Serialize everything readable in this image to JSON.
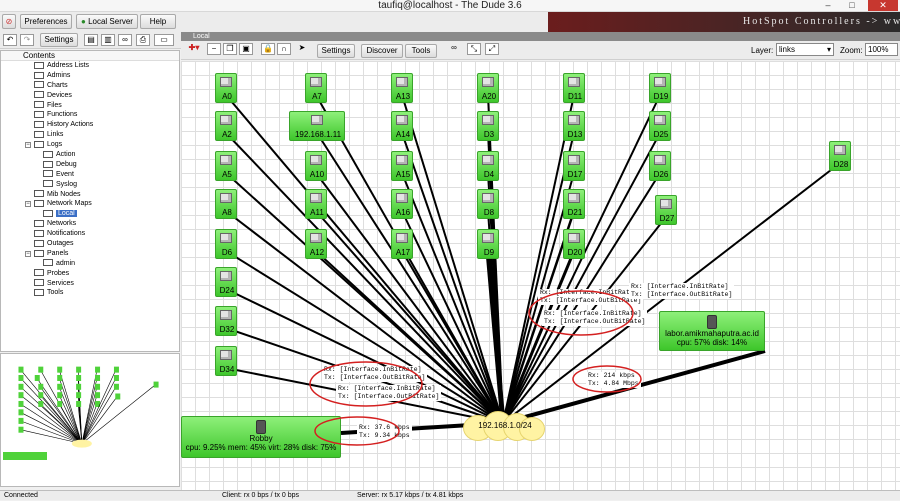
{
  "window": {
    "title": "taufiq@localhost - The Dude 3.6",
    "minimize": "–",
    "maximize": "□",
    "close": "✕"
  },
  "menu": {
    "preferences": "Preferences",
    "local_server": "Local Server",
    "help": "Help"
  },
  "banner": {
    "text": "HotSpot Controllers -> www"
  },
  "toolbar": {
    "settings": "Settings"
  },
  "tree": {
    "header": "Contents",
    "items": [
      {
        "label": "Address Lists",
        "indent": 1
      },
      {
        "label": "Admins",
        "indent": 1
      },
      {
        "label": "Charts",
        "indent": 1
      },
      {
        "label": "Devices",
        "indent": 1
      },
      {
        "label": "Files",
        "indent": 1
      },
      {
        "label": "Functions",
        "indent": 1
      },
      {
        "label": "History Actions",
        "indent": 1
      },
      {
        "label": "Links",
        "indent": 1
      },
      {
        "label": "Logs",
        "indent": 1,
        "expander": "−"
      },
      {
        "label": "Action",
        "indent": 2
      },
      {
        "label": "Debug",
        "indent": 2
      },
      {
        "label": "Event",
        "indent": 2
      },
      {
        "label": "Syslog",
        "indent": 2
      },
      {
        "label": "Mib Nodes",
        "indent": 1
      },
      {
        "label": "Network Maps",
        "indent": 1,
        "expander": "−"
      },
      {
        "label": "Local",
        "indent": 2,
        "selected": true
      },
      {
        "label": "Networks",
        "indent": 1
      },
      {
        "label": "Notifications",
        "indent": 1
      },
      {
        "label": "Outages",
        "indent": 1
      },
      {
        "label": "Panels",
        "indent": 1,
        "expander": "−"
      },
      {
        "label": "admin",
        "indent": 2
      },
      {
        "label": "Probes",
        "indent": 1
      },
      {
        "label": "Services",
        "indent": 1
      },
      {
        "label": "Tools",
        "indent": 1
      }
    ]
  },
  "map_tab": {
    "label": "Local"
  },
  "map_toolbar": {
    "settings": "Settings",
    "discover": "Discover",
    "tools": "Tools",
    "layer_label": "Layer:",
    "layer_value": "links",
    "zoom_label": "Zoom:",
    "zoom_value": "100%"
  },
  "map": {
    "hub": {
      "label": "192.168.1.0/24"
    },
    "nodes": [
      {
        "id": "A0",
        "label": "A0"
      },
      {
        "id": "A2",
        "label": "A2"
      },
      {
        "id": "A5",
        "label": "A5"
      },
      {
        "id": "A8",
        "label": "A8"
      },
      {
        "id": "D6",
        "label": "D6"
      },
      {
        "id": "D24",
        "label": "D24"
      },
      {
        "id": "D32",
        "label": "D32"
      },
      {
        "id": "D34",
        "label": "D34"
      },
      {
        "id": "A7",
        "label": "A7"
      },
      {
        "id": "ip11",
        "label": "192.168.1.11"
      },
      {
        "id": "A10",
        "label": "A10"
      },
      {
        "id": "A11",
        "label": "A11"
      },
      {
        "id": "A12",
        "label": "A12"
      },
      {
        "id": "A13",
        "label": "A13"
      },
      {
        "id": "A14",
        "label": "A14"
      },
      {
        "id": "A15",
        "label": "A15"
      },
      {
        "id": "A16",
        "label": "A16"
      },
      {
        "id": "A17",
        "label": "A17"
      },
      {
        "id": "A20",
        "label": "A20"
      },
      {
        "id": "D3",
        "label": "D3"
      },
      {
        "id": "D4",
        "label": "D4"
      },
      {
        "id": "D8",
        "label": "D8"
      },
      {
        "id": "D9",
        "label": "D9"
      },
      {
        "id": "D11",
        "label": "D11"
      },
      {
        "id": "D13",
        "label": "D13"
      },
      {
        "id": "D17",
        "label": "D17"
      },
      {
        "id": "D21",
        "label": "D21"
      },
      {
        "id": "D20",
        "label": "D20"
      },
      {
        "id": "D19",
        "label": "D19"
      },
      {
        "id": "D25",
        "label": "D25"
      },
      {
        "id": "D26",
        "label": "D26"
      },
      {
        "id": "D27",
        "label": "D27"
      },
      {
        "id": "D28",
        "label": "D28"
      }
    ],
    "robby": {
      "name": "Robby",
      "stats": "cpu: 9.25% mem: 45% virt: 28% disk: 75%"
    },
    "server": {
      "name": "labor.amikmahaputra.ac.id",
      "stats": "cpu: 57% disk: 14%"
    },
    "link_labels": {
      "left1": {
        "rx": "Rx: [Interface.InBitRate]",
        "tx": "Tx: [Interface.OutBitRate]"
      },
      "left2": {
        "rx": "Rx: [Interface.InBitRate]",
        "tx": "Tx: [Interface.OutBitRate]"
      },
      "robby": {
        "rx": "Rx: 37.6 kbps",
        "tx": "Tx: 9.34 kbps"
      },
      "right1": {
        "rx": "Rx: [Interface.InBitRate]",
        "tx": "Tx: [Interface.OutBitRate]"
      },
      "right2": {
        "rx": "Rx: [Interface.InBitRate]",
        "tx": "Tx: [Interface.OutBitRate]"
      },
      "right3": {
        "rx": "Rx: [Interface.InBitRate]",
        "tx": "Tx: [Interface.OutBitRate]"
      },
      "server": {
        "rx": "Rx: 214 kbps",
        "tx": "Tx: 4.84 Mbps"
      }
    },
    "annotation_color": "#d42020",
    "node_color": "#4fd23a"
  },
  "status": {
    "connection": "Connected",
    "client": "Client: rx 0 bps / tx 0 bps",
    "server": "Server: rx 5.17 kbps / tx 4.81 kbps"
  }
}
